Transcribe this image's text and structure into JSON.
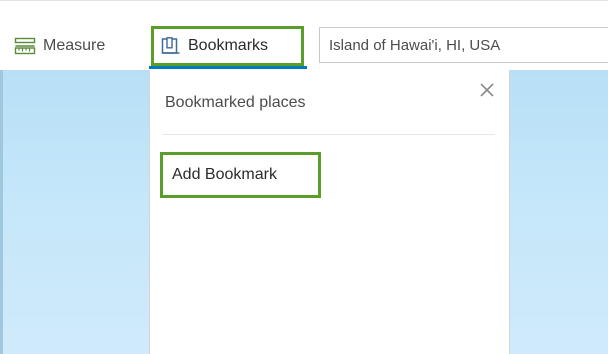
{
  "toolbar": {
    "measure_label": "Measure",
    "measure_icon": "ruler-icon",
    "bookmarks_label": "Bookmarks",
    "bookmarks_icon": "bookmark-icon",
    "search_value": "Island of Hawai'i, HI, USA"
  },
  "bookmarks_panel": {
    "title": "Bookmarked places",
    "close_icon": "close-icon",
    "add_button_label": "Add Bookmark"
  },
  "colors": {
    "highlight_border": "#5a9e2a",
    "active_tab_underline": "#0079c1",
    "map_water": "#c5e7fa"
  }
}
